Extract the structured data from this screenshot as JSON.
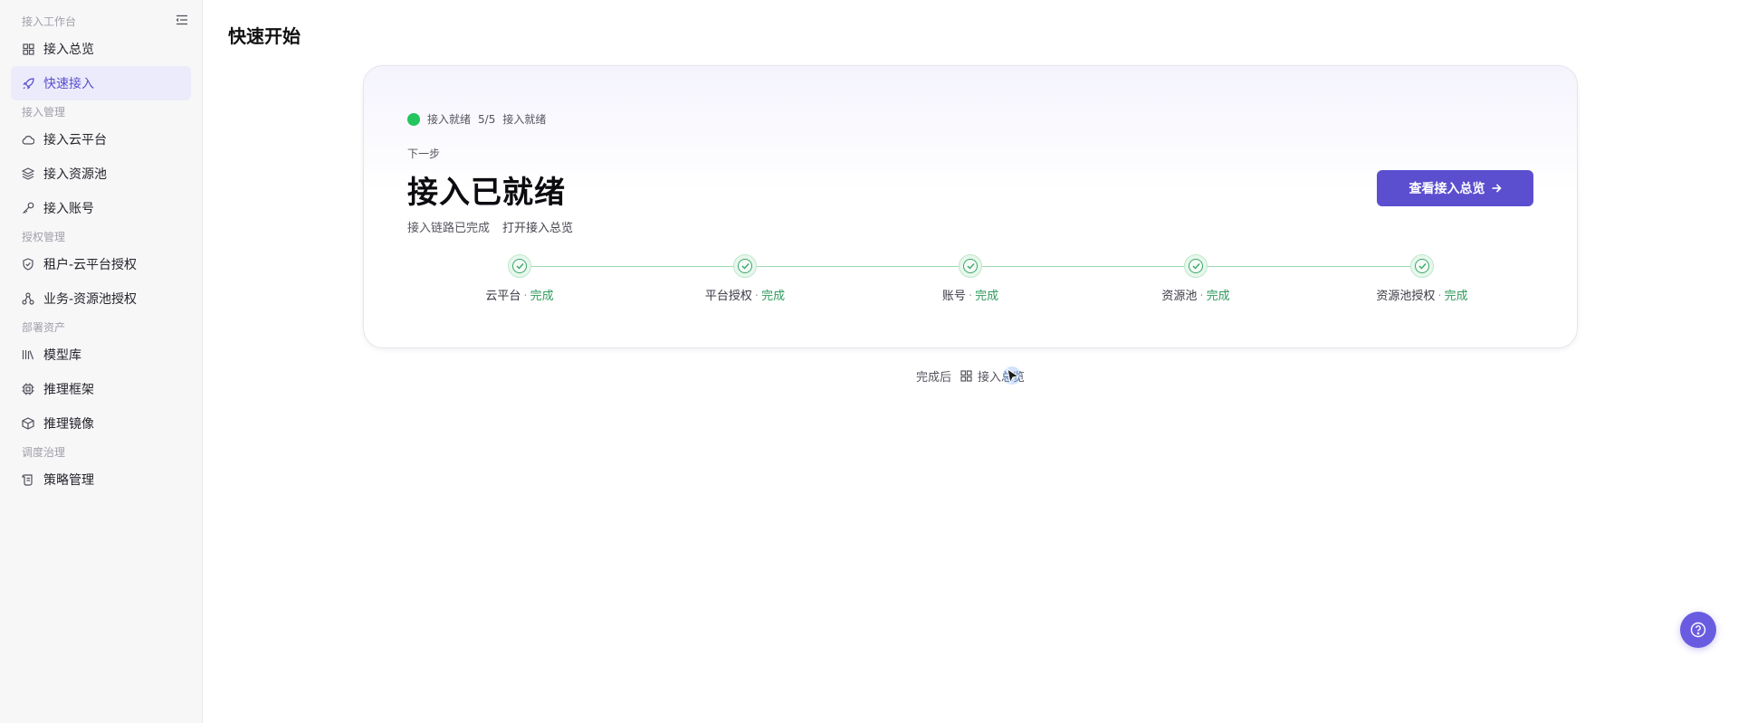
{
  "sidebar": {
    "groups": [
      {
        "label": "接入工作台",
        "items": [
          {
            "label": "接入总览",
            "icon": "grid-icon"
          },
          {
            "label": "快速接入",
            "icon": "rocket-icon",
            "active": true
          }
        ]
      },
      {
        "label": "接入管理",
        "items": [
          {
            "label": "接入云平台",
            "icon": "cloud-icon"
          },
          {
            "label": "接入资源池",
            "icon": "layers-icon"
          },
          {
            "label": "接入账号",
            "icon": "key-icon"
          }
        ]
      },
      {
        "label": "授权管理",
        "items": [
          {
            "label": "租户-云平台授权",
            "icon": "shield-icon"
          },
          {
            "label": "业务-资源池授权",
            "icon": "nodes-icon"
          }
        ]
      },
      {
        "label": "部署资产",
        "items": [
          {
            "label": "模型库",
            "icon": "library-icon"
          },
          {
            "label": "推理框架",
            "icon": "chip-icon"
          },
          {
            "label": "推理镜像",
            "icon": "box-icon"
          }
        ]
      },
      {
        "label": "调度治理",
        "items": [
          {
            "label": "策略管理",
            "icon": "scroll-icon"
          }
        ]
      }
    ]
  },
  "page": {
    "title": "快速开始"
  },
  "card": {
    "status_text": "接入就绪",
    "status_count": "5/5",
    "status_suffix": "接入就绪",
    "next_label": "下一步",
    "headline": "接入已就绪",
    "sub_text": "接入链路已完成",
    "sub_link": "打开接入总览",
    "primary_button": "查看接入总览",
    "steps": [
      {
        "label": "云平台",
        "status": "完成"
      },
      {
        "label": "平台授权",
        "status": "完成"
      },
      {
        "label": "账号",
        "status": "完成"
      },
      {
        "label": "资源池",
        "status": "完成"
      },
      {
        "label": "资源池授权",
        "status": "完成"
      }
    ]
  },
  "footer": {
    "after_label": "完成后",
    "after_link": "接入总览"
  },
  "colors": {
    "accent": "#5b4fcf",
    "success": "#22c55e",
    "done_text": "#2f9a5c"
  }
}
